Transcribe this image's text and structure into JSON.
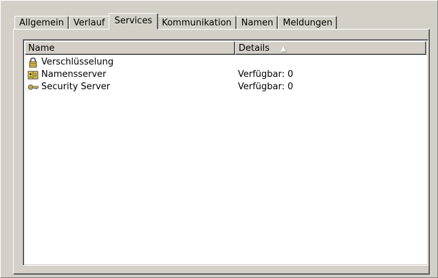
{
  "tabs": [
    {
      "label": "Allgemein"
    },
    {
      "label": "Verlauf"
    },
    {
      "label": "Services",
      "active": true
    },
    {
      "label": "Kommunikation"
    },
    {
      "label": "Namen"
    },
    {
      "label": "Meldungen"
    }
  ],
  "list": {
    "columns": {
      "name": "Name",
      "details": "Details"
    },
    "sort_column": "details",
    "sort_direction": "ascending",
    "rows": [
      {
        "name": "Verschlüsselung",
        "details": "",
        "icon": "lock-icon"
      },
      {
        "name": "Namensserver",
        "details": "Verfügbar: 0",
        "icon": "address-book-icon"
      },
      {
        "name": "Security Server",
        "details": "Verfügbar: 0",
        "icon": "key-icon"
      }
    ]
  }
}
